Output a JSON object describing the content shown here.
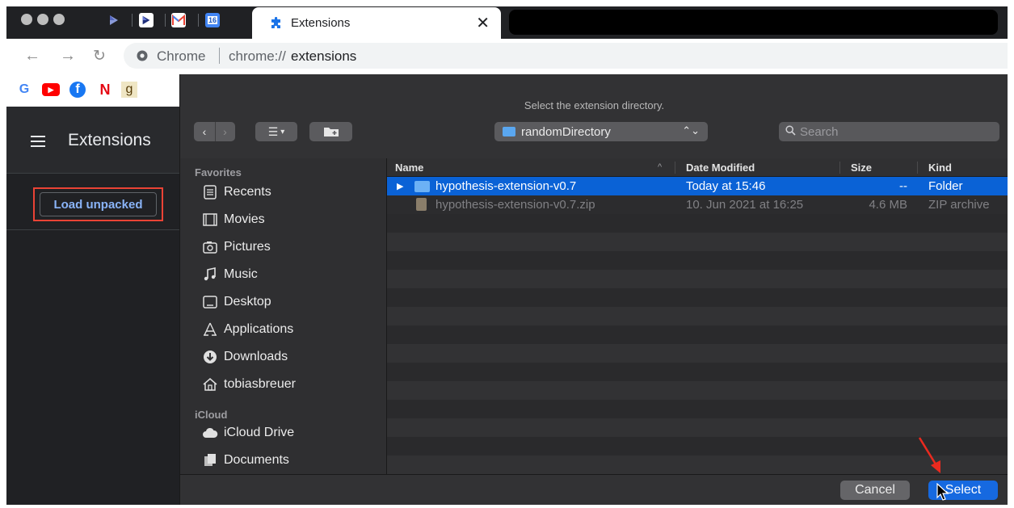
{
  "browser": {
    "pinned_tabs": [
      "m-mail-icon",
      "calendar-16-icon"
    ],
    "calendar_day": "16",
    "active_tab": {
      "title": "Extensions",
      "close": "✕"
    },
    "address": {
      "chrome_label": "Chrome",
      "url_prefix": "chrome://",
      "url_host": "extensions"
    },
    "bookmarks": [
      "G",
      "▶",
      "f",
      "N",
      "g"
    ]
  },
  "extensions_page": {
    "title": "Extensions",
    "load_unpacked_label": "Load unpacked"
  },
  "dialog": {
    "title": "Select the extension directory.",
    "location": "randomDirectory",
    "search_placeholder": "Search",
    "sidebar": {
      "favorites_label": "Favorites",
      "favorites": [
        {
          "label": "Recents",
          "icon": "recents-icon"
        },
        {
          "label": "Movies",
          "icon": "movies-icon"
        },
        {
          "label": "Pictures",
          "icon": "pictures-icon"
        },
        {
          "label": "Music",
          "icon": "music-icon"
        },
        {
          "label": "Desktop",
          "icon": "desktop-icon"
        },
        {
          "label": "Applications",
          "icon": "applications-icon"
        },
        {
          "label": "Downloads",
          "icon": "downloads-icon"
        },
        {
          "label": "tobiasbreuer",
          "icon": "home-icon"
        }
      ],
      "icloud_label": "iCloud",
      "icloud": [
        {
          "label": "iCloud Drive",
          "icon": "cloud-icon"
        },
        {
          "label": "Documents",
          "icon": "documents-icon"
        }
      ]
    },
    "columns": {
      "name": "Name",
      "date": "Date Modified",
      "size": "Size",
      "kind": "Kind"
    },
    "files": [
      {
        "name": "hypothesis-extension-v0.7",
        "date": "Today at 15:46",
        "size": "--",
        "kind": "Folder",
        "selected": true
      },
      {
        "name": "hypothesis-extension-v0.7.zip",
        "date": "10. Jun 2021 at 16:25",
        "size": "4.6 MB",
        "kind": "ZIP archive",
        "selected": false
      }
    ],
    "buttons": {
      "cancel": "Cancel",
      "select": "Select"
    }
  },
  "colors": {
    "selection": "#0a62d6",
    "highlight_box": "#ea4335",
    "primary_button": "#1669e0",
    "link_blue": "#8ab4f8"
  }
}
